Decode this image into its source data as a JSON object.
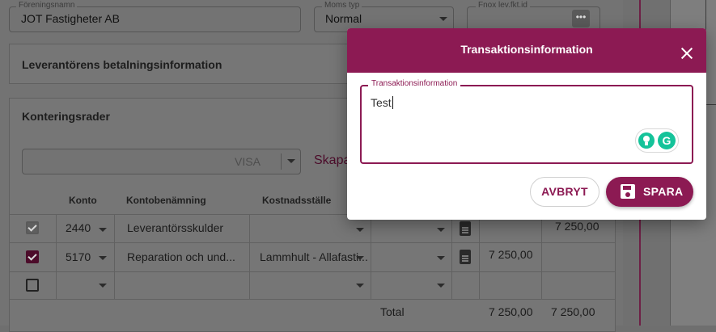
{
  "form": {
    "foreningsnamn_label": "Föreningsnamn",
    "foreningsnamn_value": "JOT Fastigheter AB",
    "moms_label": "Moms typ",
    "moms_value": "Normal",
    "fnox_label": "Fnox lev.fkt.id"
  },
  "sections": {
    "payment_title": "Leverantörens betalningsinformation",
    "rows_title": "Konteringsrader"
  },
  "controls": {
    "visa_placeholder": "VISA",
    "skapa_label": "Skapa"
  },
  "table": {
    "headers": [
      "Konto",
      "Kontobenämning",
      "Kostnadsställe"
    ],
    "rows": [
      {
        "checked": true,
        "disabled": true,
        "konto": "2440",
        "benamning": "Leverantörsskulder",
        "kostnadsstalle": "",
        "debet": "",
        "kredit": "7 250,00"
      },
      {
        "checked": true,
        "disabled": false,
        "konto": "5170",
        "benamning": "Reparation och und...",
        "kostnadsstalle": "Lammhult - Allafasti...",
        "debet": "7 250,00",
        "kredit": ""
      },
      {
        "checked": false,
        "disabled": false,
        "konto": "",
        "benamning": "",
        "kostnadsstalle": "",
        "debet": "",
        "kredit": ""
      }
    ],
    "total_label": "Total",
    "total_debet": "7 250,00",
    "total_kredit": "7 250,00"
  },
  "dialog": {
    "title": "Transaktionsinformation",
    "field_label": "Transaktionsinformation",
    "field_value": "Test",
    "cancel_label": "AVBRYT",
    "save_label": "SPARA",
    "accent_color": "#8c1a53"
  },
  "icons": [
    "close-icon",
    "save-icon",
    "document-icon",
    "chevron-down-icon",
    "more-icon",
    "grammarly-icon",
    "lightbulb-icon",
    "checkbox-icon"
  ]
}
